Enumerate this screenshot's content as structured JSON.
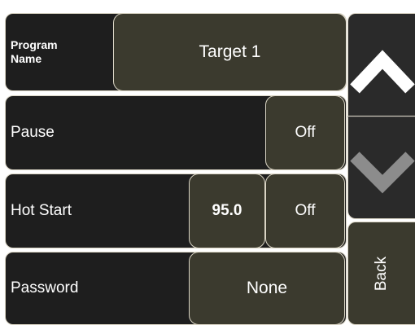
{
  "rows": {
    "program_name": {
      "label": "Program\nName",
      "value": "Target 1"
    },
    "pause": {
      "label": "Pause",
      "toggle": "Off"
    },
    "hot_start": {
      "label": "Hot Start",
      "temperature": "95.0",
      "toggle": "Off"
    },
    "password": {
      "label": "Password",
      "value": "None"
    }
  },
  "side_nav": {
    "scroll_up_icon": "chevron-up-icon",
    "scroll_down_icon": "chevron-down-icon",
    "back_label": "Back"
  },
  "colors": {
    "panel_bg": "#1e1e1e",
    "button_bg": "#3b3a2e",
    "border": "#d9d4c4",
    "nav_bg": "#2a2a2a",
    "chevron_up": "#ffffff",
    "chevron_down": "#8c8c8c"
  }
}
